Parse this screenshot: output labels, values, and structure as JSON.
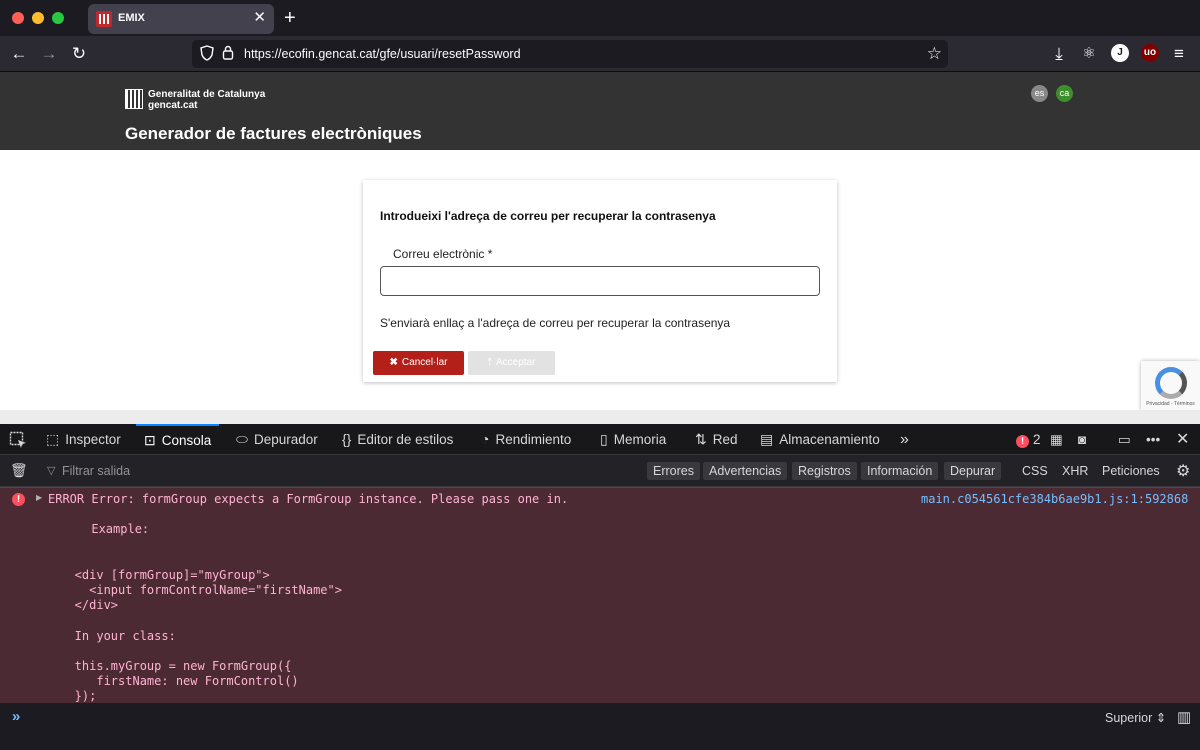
{
  "browser": {
    "tab_title": "EMIX",
    "tab_close": "✕",
    "new_tab": "+",
    "url": "https://ecofin.gencat.cat/gfe/usuari/resetPassword",
    "ext_j": "J",
    "ext_ub": "uo"
  },
  "site": {
    "logo_line1": "Generalitat de Catalunya",
    "logo_line2": "gencat.cat",
    "title": "Generador de factures electròniques",
    "lang_es": "es",
    "lang_ca": "ca",
    "accent_color": "#b3201a"
  },
  "form": {
    "heading": "Introdueixi l'adreça de correu per recuperar la contrasenya",
    "email_label": "Correu electrònic *",
    "email_value": "",
    "hint": "S'enviarà enllaç a l'adreça de correu per recuperar la contrasenya",
    "cancel_label": "Cancel·lar",
    "accept_label": "Acceptar"
  },
  "recaptcha": {
    "text": "Privacidad - Términos"
  },
  "devtools": {
    "tabs": [
      "Inspector",
      "Consola",
      "Depurador",
      "Editor de estilos",
      "Rendimiento",
      "Memoria",
      "Red",
      "Almacenamiento"
    ],
    "error_count": "2",
    "filter_placeholder": "Filtrar salida",
    "filters": [
      "Errores",
      "Advertencias",
      "Registros",
      "Información",
      "Depurar"
    ],
    "filters_plain": [
      "CSS",
      "XHR",
      "Peticiones"
    ],
    "error_source": "main.c054561cfe384b6ae9b1.js:1:592868",
    "error_lines": [
      "ERROR Error: formGroup expects a FormGroup instance. Please pass one in.",
      "",
      "      Example:",
      "",
      "",
      "   <div [formGroup]=\"myGroup\">",
      "     <input formControlName=\"firstName\">",
      "   </div>",
      "",
      "   In your class:",
      "",
      "   this.myGroup = new FormGroup({",
      "      firstName: new FormControl()",
      "   });"
    ],
    "context_selector": "Superior ⇕"
  }
}
